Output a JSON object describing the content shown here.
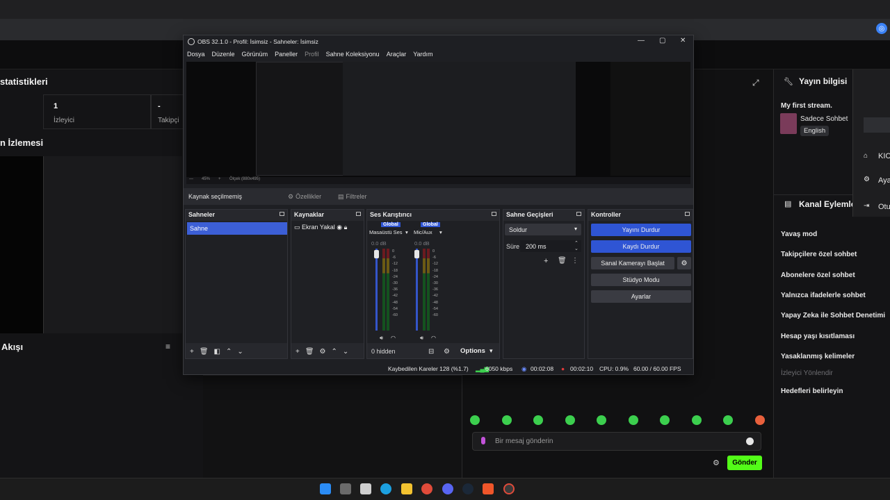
{
  "obs": {
    "title": "OBS 32.1.0 - Profil: İsimsiz - Sahneler: İsimsiz",
    "menu": [
      "Dosya",
      "Düzenle",
      "Görünüm",
      "Paneller",
      "Profil",
      "Sahne Koleksiyonu",
      "Araçlar",
      "Yardım"
    ],
    "preview": {
      "zoom": "45%",
      "scale": "Ölçek (880x495)"
    },
    "no_source": "Kaynak seçilmemiş",
    "properties_label": "Özellikler",
    "filters_label": "Filtreler",
    "docks": {
      "scenes": {
        "title": "Sahneler",
        "items": [
          "Sahne"
        ]
      },
      "sources": {
        "title": "Kaynaklar",
        "items": [
          "Ekran Yakal"
        ]
      },
      "mixer": {
        "title": "Ses Karıştırıcı",
        "channels": [
          {
            "tag": "Global",
            "name": "Masaüstü Ses",
            "db": "0.0 dB"
          },
          {
            "tag": "Global",
            "name": "Mic/Aux",
            "db": "0.0 dB"
          }
        ],
        "scale": [
          "0",
          "-6",
          "-12",
          "-18",
          "-24",
          "-30",
          "-36",
          "-42",
          "-48",
          "-54",
          "-60"
        ],
        "hidden": "0 hidden",
        "options": "Options"
      },
      "transitions": {
        "title": "Sahne Geçişleri",
        "type": "Soldur",
        "duration_label": "Süre",
        "duration": "200 ms"
      },
      "controls": {
        "title": "Kontroller",
        "buttons": [
          "Yayını Durdur",
          "Kaydı Durdur",
          "Sanal Kamerayı Başlat",
          "Stüdyo Modu",
          "Ayarlar"
        ]
      }
    },
    "status": {
      "dropped": "Kaybedilen Kareler 128 (%1.7)",
      "bitrate": "6050 kbps",
      "stream_time": "00:02:08",
      "rec_time": "00:02:10",
      "cpu": "CPU: 0.9%",
      "fps": "60.00 / 60.00 FPS"
    }
  },
  "dashboard": {
    "stats_title": "statistikleri",
    "viewers_value": "1",
    "viewers_label": "İzleyici",
    "followers_value": "-",
    "followers_label": "Takipçi",
    "watch_title": "n İzlemesi",
    "flow_title": "Akışı"
  },
  "stream_info": {
    "title": "Yayın bilgisi",
    "stream_name": "My first stream.",
    "category": "Sadece Sohbet",
    "language": "English"
  },
  "channel_actions": {
    "title": "Kanal Eylemle",
    "items": [
      "Yavaş mod",
      "Takipçilere özel sohbet",
      "Abonelere özel sohbet",
      "Yalnızca ifadelerle sohbet",
      "Yapay Zeka ile Sohbet Denetimi",
      "Hesap yaşı kısıtlaması",
      "Yasaklanmış kelimeler",
      "İzleyici Yönlendir",
      "Hedefleri belirleyin"
    ]
  },
  "kick_menu": {
    "items": [
      "KIC",
      "Aya",
      "Otu"
    ]
  },
  "chat": {
    "placeholder": "Bir mesaj gönderin",
    "send": "Gönder"
  },
  "colors": {
    "accent_blue": "#2f55d4",
    "kick_green": "#53fc18"
  }
}
